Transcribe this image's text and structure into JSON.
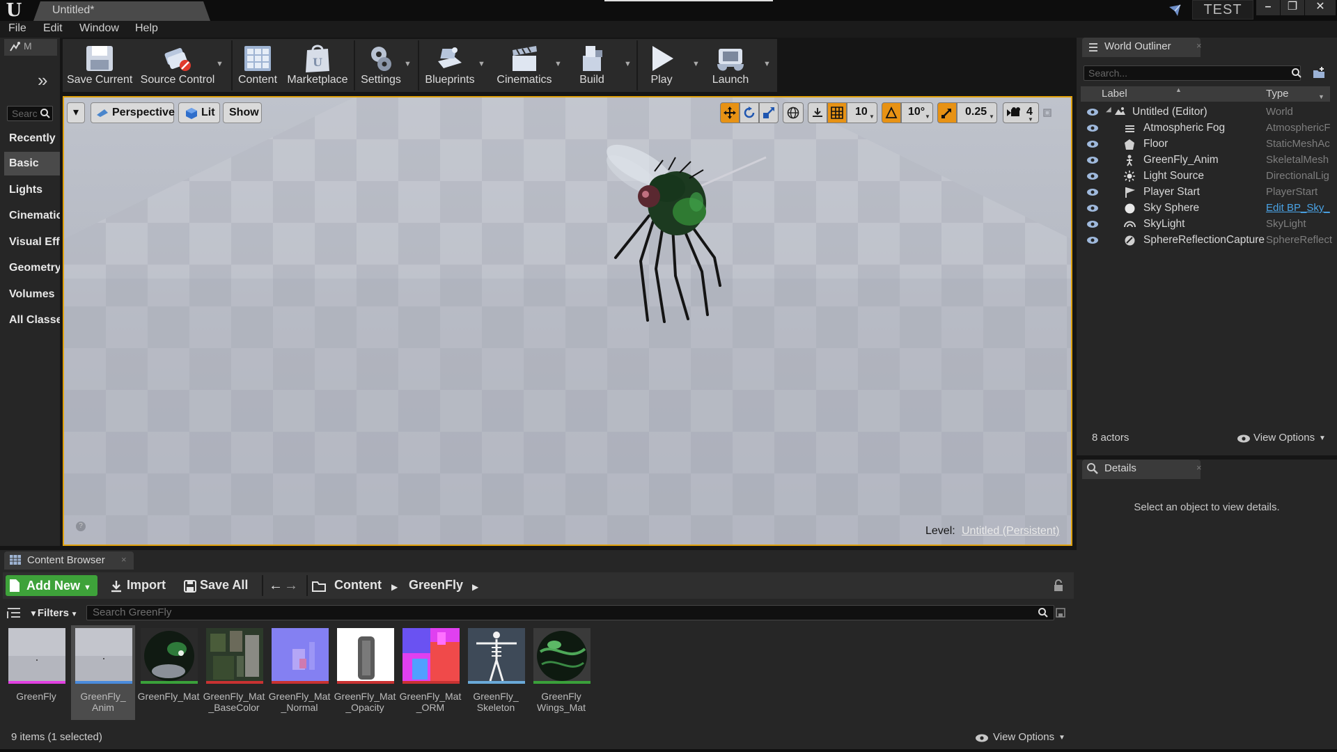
{
  "titlebar": {
    "doc_tab": "Untitled*",
    "test_label": "TEST",
    "minimize": "–",
    "maximize": "❐",
    "close": "✕"
  },
  "menu": [
    "File",
    "Edit",
    "Window",
    "Help"
  ],
  "modes": {
    "tab_label": "M",
    "search_placeholder": "Searc",
    "categories": [
      "Recently",
      "Basic",
      "Lights",
      "Cinematic",
      "Visual Eff",
      "Geometry",
      "Volumes",
      "All Classe"
    ],
    "active_category": "Basic"
  },
  "toolbar": {
    "save_current": "Save Current",
    "source_control": "Source Control",
    "content": "Content",
    "marketplace": "Marketplace",
    "settings": "Settings",
    "blueprints": "Blueprints",
    "cinematics": "Cinematics",
    "build": "Build",
    "play": "Play",
    "launch": "Launch"
  },
  "viewport": {
    "menu_dropdown": "▾",
    "perspective": "Perspective",
    "lit": "Lit",
    "show": "Show",
    "grid_snap": "10",
    "rotation_snap": "10°",
    "scale_snap": "0.25",
    "camera_speed": "4",
    "level_label": "Level:",
    "level_value": "Untitled (Persistent)"
  },
  "outliner": {
    "tab_label": "World Outliner",
    "search_placeholder": "Search...",
    "col_label": "Label",
    "col_type": "Type",
    "rows": [
      {
        "label": "Untitled (Editor)",
        "type": "World"
      },
      {
        "label": "Atmospheric Fog",
        "type": "AtmosphericF"
      },
      {
        "label": "Floor",
        "type": "StaticMeshAc"
      },
      {
        "label": "GreenFly_Anim",
        "type": "SkeletalMesh"
      },
      {
        "label": "Light Source",
        "type": "DirectionalLig"
      },
      {
        "label": "Player Start",
        "type": "PlayerStart"
      },
      {
        "label": "Sky Sphere",
        "type": "Edit BP_Sky_"
      },
      {
        "label": "SkyLight",
        "type": "SkyLight"
      },
      {
        "label": "SphereReflectionCapture",
        "type": "SphereReflect"
      }
    ],
    "actor_count": "8 actors",
    "view_options": "View Options"
  },
  "details": {
    "tab_label": "Details",
    "empty_message": "Select an object to view details."
  },
  "content_browser": {
    "tab_label": "Content Browser",
    "add_new": "Add New",
    "import": "Import",
    "save_all": "Save All",
    "path": [
      "Content",
      "GreenFly"
    ],
    "filters": "Filters",
    "search_placeholder": "Search GreenFly",
    "assets": [
      {
        "name": "GreenFly",
        "bar_color": "#e040e0"
      },
      {
        "name": "GreenFly_\nAnim",
        "bar_color": "#4a8bdc"
      },
      {
        "name": "GreenFly_Mat",
        "bar_color": "#3aa03a"
      },
      {
        "name": "GreenFly_Mat\n_BaseColor",
        "bar_color": "#c83232"
      },
      {
        "name": "GreenFly_Mat\n_Normal",
        "bar_color": "#c83232"
      },
      {
        "name": "GreenFly_Mat\n_Opacity",
        "bar_color": "#c83232"
      },
      {
        "name": "GreenFly_Mat\n_ORM",
        "bar_color": "#c83232"
      },
      {
        "name": "GreenFly_\nSkeleton",
        "bar_color": "#6aa9d8"
      },
      {
        "name": "GreenFly\nWings_Mat",
        "bar_color": "#3aa03a"
      }
    ],
    "selected_asset": "GreenFly_Anim",
    "status": "9 items (1 selected)",
    "view_options": "View Options"
  },
  "colors": {
    "viewport_border": "#e0a10c",
    "add_new_green": "#3ea23a",
    "link_blue": "#4aa3e6",
    "snap_orange": "#e79214"
  }
}
